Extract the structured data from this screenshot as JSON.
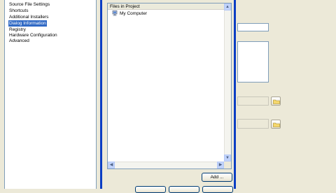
{
  "tree": {
    "items": [
      {
        "label": "Source File Settings",
        "selected": false
      },
      {
        "label": "Shortcuts",
        "selected": false
      },
      {
        "label": "Additional Installers",
        "selected": false
      },
      {
        "label": "Dialog Information",
        "selected": true
      },
      {
        "label": "Registry",
        "selected": false
      },
      {
        "label": "Hardware Configuration",
        "selected": false
      },
      {
        "label": "Advanced",
        "selected": false
      }
    ]
  },
  "files_panel": {
    "header": "Files in Project",
    "root_node": "My Computer"
  },
  "buttons": {
    "add": "Add ...",
    "bottom": [
      "",
      "",
      ""
    ]
  },
  "colors": {
    "selection": "#316ac5",
    "dialog_border": "#0a3dc4",
    "background": "#ece9d8"
  },
  "icons": {
    "computer": "computer-icon",
    "folder": "folder-icon"
  }
}
